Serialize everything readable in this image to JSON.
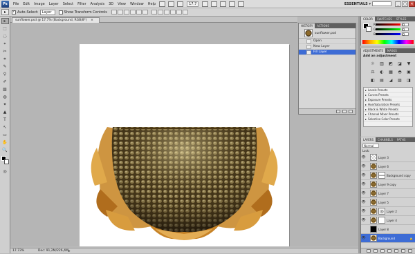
{
  "app": {
    "logo": "Ps",
    "workspace": "ESSENTIALS ▾"
  },
  "menubar": {
    "items": [
      "File",
      "Edit",
      "Image",
      "Layer",
      "Select",
      "Filter",
      "Analysis",
      "3D",
      "View",
      "Window",
      "Help"
    ],
    "zoom": "17.7",
    "window_buttons": [
      "_",
      "▢",
      "✕"
    ]
  },
  "options": {
    "auto_select_label": "Auto-Select:",
    "auto_select_value": "Layer",
    "show_transform_label": "Show Transform Controls"
  },
  "document": {
    "tab_title": "sunflower.psd @ 17.7% (Background, RGB/8*)",
    "tab_close": "×",
    "status_zoom": "17.73%",
    "status_doc": "Doc: 91,2M/226,4M",
    "status_arrow": "▸"
  },
  "history": {
    "tabs": [
      "HISTORY",
      "ACTIONS"
    ],
    "snapshot": "sunflower.psd",
    "items": [
      {
        "label": "Open",
        "active": false
      },
      {
        "label": "New Layer",
        "active": false
      },
      {
        "label": "Fill Layer",
        "active": true
      }
    ]
  },
  "color": {
    "tabs": [
      "COLOR",
      "SWATCHES",
      "STYLES"
    ],
    "channels": [
      "R",
      "G",
      "B"
    ],
    "values": [
      "0",
      "0",
      "0"
    ]
  },
  "adjustments": {
    "tabs": [
      "ADJUSTMENTS",
      "MASKS"
    ],
    "title": "Add an adjustment",
    "icons_row1": [
      "☼",
      "▥",
      "◩",
      "◪",
      "▼"
    ],
    "icons_row2": [
      "⚖",
      "◐",
      "▦",
      "◓",
      "▣"
    ],
    "icons_row3": [
      "◧",
      "▤",
      "◢",
      "▨",
      "◨"
    ],
    "presets": [
      "Levels Presets",
      "Curves Presets",
      "Exposure Presets",
      "Hue/Saturation Presets",
      "Black & White Presets",
      "Channel Mixer Presets",
      "Selective Color Presets"
    ]
  },
  "layers": {
    "tabs": [
      "LAYERS",
      "CHANNELS",
      "PATHS"
    ],
    "blend_mode": "Normal",
    "lock_label": "Lock:",
    "items": [
      {
        "name": "Layer 3",
        "thumb": "blank",
        "mask": "",
        "selected": false
      },
      {
        "name": "Layer 6",
        "thumb": "sf",
        "mask": "",
        "selected": false
      },
      {
        "name": "Background copy",
        "thumb": "sf",
        "mask": "maskwave",
        "selected": false
      },
      {
        "name": "Layer 9 copy",
        "thumb": "sf",
        "mask": "",
        "selected": false
      },
      {
        "name": "Layer 7",
        "thumb": "sf",
        "mask": "",
        "selected": false
      },
      {
        "name": "Layer 5",
        "thumb": "sf",
        "mask": "",
        "selected": false
      },
      {
        "name": "Layer 2",
        "thumb": "sf",
        "mask": "levels",
        "selected": false
      },
      {
        "name": "Layer 4",
        "thumb": "sf",
        "mask": "mask",
        "selected": false
      },
      {
        "name": "Layer 8",
        "thumb": "black",
        "mask": "",
        "selected": false
      },
      {
        "name": "Background",
        "thumb": "sf",
        "mask": "",
        "selected": true
      }
    ]
  },
  "tools": [
    "▸",
    "⬚",
    "◌",
    "⌖",
    "✂",
    "⌗",
    "✎",
    "⚲",
    "✐",
    "▧",
    "◍",
    "✦",
    "▲",
    "T",
    "↖",
    "▭",
    "✋",
    "🔍"
  ]
}
